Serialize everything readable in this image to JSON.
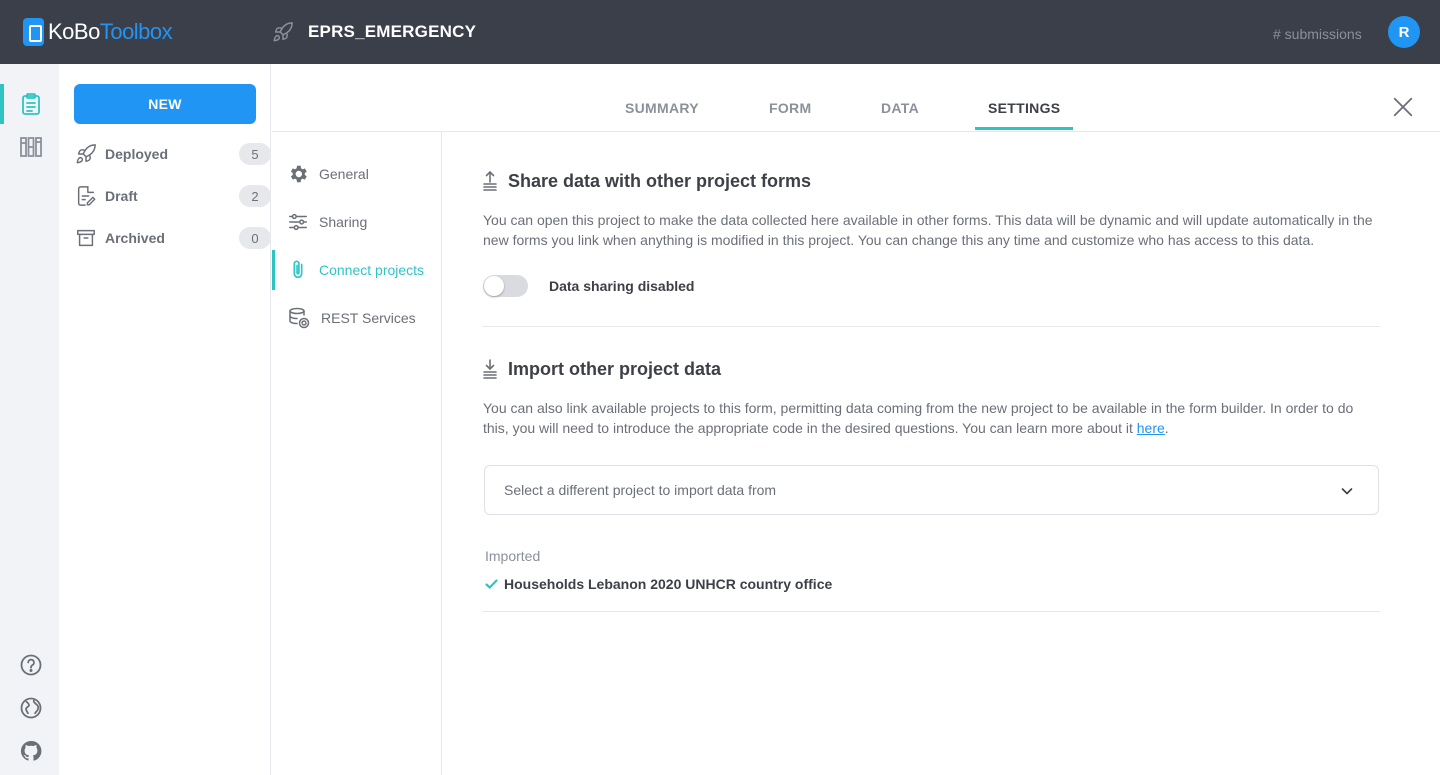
{
  "header": {
    "logo_part1": "KoBo",
    "logo_part2": "Toolbox",
    "project_title": "EPRS_EMERGENCY",
    "submissions": "# submissions",
    "avatar_initial": "R"
  },
  "sidebar": {
    "new_label": "NEW",
    "items": [
      {
        "label": "Deployed",
        "count": "5"
      },
      {
        "label": "Draft",
        "count": "2"
      },
      {
        "label": "Archived",
        "count": "0"
      }
    ]
  },
  "tabs": [
    {
      "label": "SUMMARY"
    },
    {
      "label": "FORM"
    },
    {
      "label": "DATA"
    },
    {
      "label": "SETTINGS"
    }
  ],
  "subnav": [
    {
      "label": "General"
    },
    {
      "label": "Sharing"
    },
    {
      "label": "Connect projects"
    },
    {
      "label": "REST Services"
    }
  ],
  "share_section": {
    "title": "Share data with other project forms",
    "description": "You can open this project to make the data collected here available in other forms. This data will be dynamic and will update automatically in the new forms you link when anything is modified in this project. You can change this any time and customize who has access to this data.",
    "toggle_label": "Data sharing disabled"
  },
  "import_section": {
    "title": "Import other project data",
    "description": "You can also link available projects to this form, permitting data coming from the new project to be available in the form builder. In order to do this, you will need to introduce the appropriate code in the desired questions. You can learn more about it ",
    "link_text": "here",
    "link_suffix": ".",
    "select_placeholder": "Select a different project to import data from",
    "imported_label": "Imported",
    "imported_items": [
      "Households Lebanon 2020 UNHCR country office"
    ]
  },
  "colors": {
    "header_bg": "#3b3f4a",
    "primary_blue": "#2095f3",
    "accent_teal": "#2fc4c4"
  }
}
